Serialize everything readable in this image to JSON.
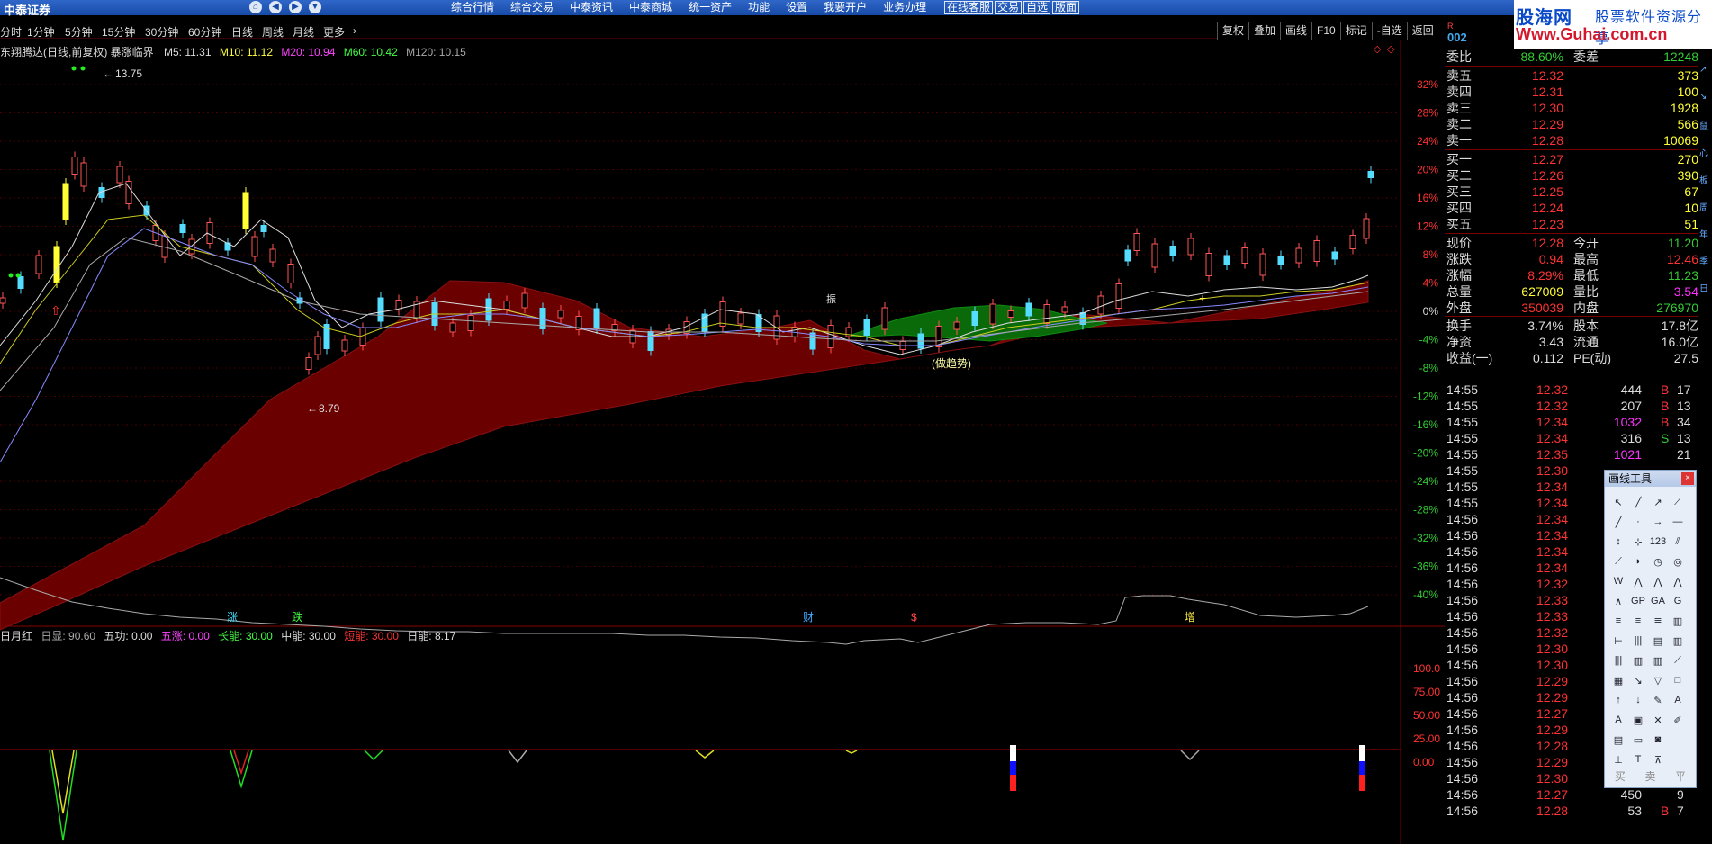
{
  "app": {
    "brand": "中泰证券",
    "top_menu": [
      "综合行情",
      "综合交易",
      "中泰资讯",
      "中泰商城",
      "统一资产",
      "功能",
      "设置",
      "我要开户",
      "业务办理"
    ],
    "top_boxes": [
      "在线客服",
      "交易",
      "自选",
      "版面"
    ]
  },
  "watermark": {
    "site_cn": "股海网",
    "slogan": "股票软件资源分享",
    "url": "Www.Guhai.com.cn"
  },
  "periods": [
    "分时",
    "1分钟",
    "5分钟",
    "15分钟",
    "30分钟",
    "60分钟",
    "日线",
    "周线",
    "月线",
    "更多"
  ],
  "toolbar_right": [
    "复权",
    "叠加",
    "画线",
    "F10",
    "标记",
    "-自选",
    "返回"
  ],
  "code_partial": "002",
  "code_r": "R",
  "main_panel": {
    "title": "东翔腾达(日线,前复权) 暴涨临界",
    "ma_labels": [
      {
        "text": "M5: 11.31",
        "color": "#dddddd"
      },
      {
        "text": "M10: 11.12",
        "color": "#ffff44"
      },
      {
        "text": "M20: 10.94",
        "color": "#ff44ff"
      },
      {
        "text": "M60: 10.42",
        "color": "#44ff44"
      },
      {
        "text": "M120: 10.15",
        "color": "#aaaaaa"
      }
    ],
    "high_label": "13.75",
    "low_label": "8.79",
    "pct_axis": [
      "32%",
      "28%",
      "24%",
      "20%",
      "16%",
      "12%",
      "8%",
      "4%",
      "0%",
      "-4%",
      "-8%",
      "-12%",
      "-16%",
      "-20%",
      "-24%",
      "-28%",
      "-32%",
      "-36%",
      "-40%"
    ],
    "trend_label": "(做趋势)",
    "event_labels": [
      {
        "text": "涨",
        "color": "#44ddff"
      },
      {
        "text": "跌",
        "color": "#44ff44"
      },
      {
        "text": "财",
        "color": "#44aaff"
      },
      {
        "text": "$",
        "color": "#ff4444"
      },
      {
        "text": "增",
        "color": "#ffee44"
      }
    ],
    "mid_label": "振"
  },
  "sub_panel": {
    "title": "日月红",
    "items": [
      {
        "text": "日显: 90.60",
        "color": "#aaaaaa"
      },
      {
        "text": "五功: 0.00",
        "color": "#dddddd"
      },
      {
        "text": "五涨: 0.00",
        "color": "#ff44ff"
      },
      {
        "text": "长能: 30.00",
        "color": "#44ff44"
      },
      {
        "text": "中能: 30.00",
        "color": "#dddddd"
      },
      {
        "text": "短能: 30.00",
        "color": "#ff3333"
      },
      {
        "text": "日能: 8.17",
        "color": "#dddddd"
      }
    ],
    "axis": [
      "100.0",
      "75.00",
      "50.00",
      "25.00",
      "0.00"
    ]
  },
  "quote": {
    "weibi": {
      "label": "委比",
      "pct": "-88.60%",
      "label2": "委差",
      "diff": "-12248"
    },
    "asks": [
      {
        "label": "卖五",
        "price": "12.32",
        "vol": "373"
      },
      {
        "label": "卖四",
        "price": "12.31",
        "vol": "100"
      },
      {
        "label": "卖三",
        "price": "12.30",
        "vol": "1928"
      },
      {
        "label": "卖二",
        "price": "12.29",
        "vol": "566"
      },
      {
        "label": "卖一",
        "price": "12.28",
        "vol": "10069"
      }
    ],
    "bids": [
      {
        "label": "买一",
        "price": "12.27",
        "vol": "270"
      },
      {
        "label": "买二",
        "price": "12.26",
        "vol": "390"
      },
      {
        "label": "买三",
        "price": "12.25",
        "vol": "67"
      },
      {
        "label": "买四",
        "price": "12.24",
        "vol": "10"
      },
      {
        "label": "买五",
        "price": "12.23",
        "vol": "51"
      }
    ],
    "stats": [
      {
        "l1": "现价",
        "v1": "12.28",
        "c1": "up",
        "l2": "今开",
        "v2": "11.20",
        "c2": "dn"
      },
      {
        "l1": "涨跌",
        "v1": "0.94",
        "c1": "up",
        "l2": "最高",
        "v2": "12.46",
        "c2": "up"
      },
      {
        "l1": "涨幅",
        "v1": "8.29%",
        "c1": "up",
        "l2": "最低",
        "v2": "11.23",
        "c2": "dn"
      },
      {
        "l1": "总量",
        "v1": "627009",
        "c1": "yl",
        "l2": "量比",
        "v2": "3.54",
        "c2": "mg"
      },
      {
        "l1": "外盘",
        "v1": "350039",
        "c1": "up",
        "l2": "内盘",
        "v2": "276970",
        "c2": "dn"
      }
    ],
    "stats2": [
      {
        "l1": "换手",
        "v1": "3.74%",
        "l2": "股本",
        "v2": "17.8亿"
      },
      {
        "l1": "净资",
        "v1": "3.43",
        "l2": "流通",
        "v2": "16.0亿"
      },
      {
        "l1": "收益(一)",
        "v1": "0.112",
        "l2": "PE(动)",
        "v2": "27.5"
      }
    ]
  },
  "ticks": [
    {
      "t": "14:55",
      "p": "12.32",
      "pc": "up",
      "v": "444",
      "vc": "wt",
      "d": "B",
      "dc": "up",
      "n": "17"
    },
    {
      "t": "14:55",
      "p": "12.32",
      "pc": "up",
      "v": "207",
      "vc": "wt",
      "d": "B",
      "dc": "up",
      "n": "13"
    },
    {
      "t": "14:55",
      "p": "12.34",
      "pc": "up",
      "v": "1032",
      "vc": "mg",
      "d": "B",
      "dc": "up",
      "n": "34"
    },
    {
      "t": "14:55",
      "p": "12.34",
      "pc": "up",
      "v": "316",
      "vc": "wt",
      "d": "S",
      "dc": "dn",
      "n": "13"
    },
    {
      "t": "14:55",
      "p": "12.35",
      "pc": "up",
      "v": "1021",
      "vc": "mg",
      "d": "",
      "dc": "wt",
      "n": "21"
    },
    {
      "t": "14:55",
      "p": "12.30",
      "pc": "up",
      "v": "",
      "vc": "wt",
      "d": "",
      "dc": "wt",
      "n": ""
    },
    {
      "t": "14:55",
      "p": "12.34",
      "pc": "up",
      "v": "",
      "vc": "wt",
      "d": "",
      "dc": "wt",
      "n": ""
    },
    {
      "t": "14:55",
      "p": "12.34",
      "pc": "up",
      "v": "",
      "vc": "wt",
      "d": "",
      "dc": "wt",
      "n": ""
    },
    {
      "t": "14:56",
      "p": "12.34",
      "pc": "up",
      "v": "",
      "vc": "wt",
      "d": "",
      "dc": "wt",
      "n": ""
    },
    {
      "t": "14:56",
      "p": "12.34",
      "pc": "up",
      "v": "",
      "vc": "wt",
      "d": "",
      "dc": "wt",
      "n": ""
    },
    {
      "t": "14:56",
      "p": "12.34",
      "pc": "up",
      "v": "",
      "vc": "wt",
      "d": "",
      "dc": "wt",
      "n": ""
    },
    {
      "t": "14:56",
      "p": "12.34",
      "pc": "up",
      "v": "",
      "vc": "wt",
      "d": "",
      "dc": "wt",
      "n": ""
    },
    {
      "t": "14:56",
      "p": "12.32",
      "pc": "up",
      "v": "",
      "vc": "wt",
      "d": "",
      "dc": "wt",
      "n": ""
    },
    {
      "t": "14:56",
      "p": "12.33",
      "pc": "up",
      "v": "",
      "vc": "wt",
      "d": "",
      "dc": "wt",
      "n": ""
    },
    {
      "t": "14:56",
      "p": "12.33",
      "pc": "up",
      "v": "",
      "vc": "wt",
      "d": "",
      "dc": "wt",
      "n": ""
    },
    {
      "t": "14:56",
      "p": "12.32",
      "pc": "up",
      "v": "",
      "vc": "wt",
      "d": "",
      "dc": "wt",
      "n": ""
    },
    {
      "t": "14:56",
      "p": "12.30",
      "pc": "up",
      "v": "",
      "vc": "wt",
      "d": "",
      "dc": "wt",
      "n": ""
    },
    {
      "t": "14:56",
      "p": "12.30",
      "pc": "up",
      "v": "",
      "vc": "wt",
      "d": "",
      "dc": "wt",
      "n": ""
    },
    {
      "t": "14:56",
      "p": "12.29",
      "pc": "up",
      "v": "",
      "vc": "wt",
      "d": "",
      "dc": "wt",
      "n": ""
    },
    {
      "t": "14:56",
      "p": "12.29",
      "pc": "up",
      "v": "",
      "vc": "wt",
      "d": "",
      "dc": "wt",
      "n": ""
    },
    {
      "t": "14:56",
      "p": "12.27",
      "pc": "up",
      "v": "",
      "vc": "wt",
      "d": "",
      "dc": "wt",
      "n": ""
    },
    {
      "t": "14:56",
      "p": "12.29",
      "pc": "up",
      "v": "",
      "vc": "wt",
      "d": "",
      "dc": "wt",
      "n": ""
    },
    {
      "t": "14:56",
      "p": "12.28",
      "pc": "up",
      "v": "",
      "vc": "wt",
      "d": "",
      "dc": "wt",
      "n": ""
    },
    {
      "t": "14:56",
      "p": "12.29",
      "pc": "up",
      "v": "",
      "vc": "wt",
      "d": "",
      "dc": "wt",
      "n": ""
    },
    {
      "t": "14:56",
      "p": "12.30",
      "pc": "up",
      "v": "",
      "vc": "wt",
      "d": "",
      "dc": "wt",
      "n": ""
    },
    {
      "t": "14:56",
      "p": "12.27",
      "pc": "up",
      "v": "450",
      "vc": "wt",
      "d": "",
      "dc": "wt",
      "n": "9"
    },
    {
      "t": "14:56",
      "p": "12.28",
      "pc": "up",
      "v": "53",
      "vc": "wt",
      "d": "B",
      "dc": "up",
      "n": "7"
    }
  ],
  "drawtools": {
    "title": "画线工具",
    "close": "×",
    "tools": [
      "↖",
      "╱",
      "↗",
      "⟋",
      "╱",
      "·",
      "→",
      "—",
      "↕",
      "⊹",
      "123",
      "⫽",
      "⟋",
      "◗",
      "◷",
      "◎",
      "W",
      "⋀",
      "⋀",
      "⋀",
      "∧",
      "GP",
      "GA",
      "G",
      "≡",
      "≡",
      "≣",
      "▥",
      "⊢",
      "|||",
      "▤",
      "▥",
      "|||",
      "▥",
      "▥",
      "⟋",
      "▦",
      "↘",
      "▽",
      "□",
      "↑",
      "↓",
      "✎",
      "A",
      "A",
      "▣",
      "✕",
      "✐",
      "▤",
      "▭",
      "◙",
      "",
      "⊥",
      "T",
      "⊼",
      ""
    ],
    "footer": [
      "买",
      "卖",
      "平"
    ]
  },
  "edge_letters": [
    "↗",
    "↘",
    "鼠",
    "心",
    "板",
    "周",
    "年",
    "季",
    "日"
  ]
}
